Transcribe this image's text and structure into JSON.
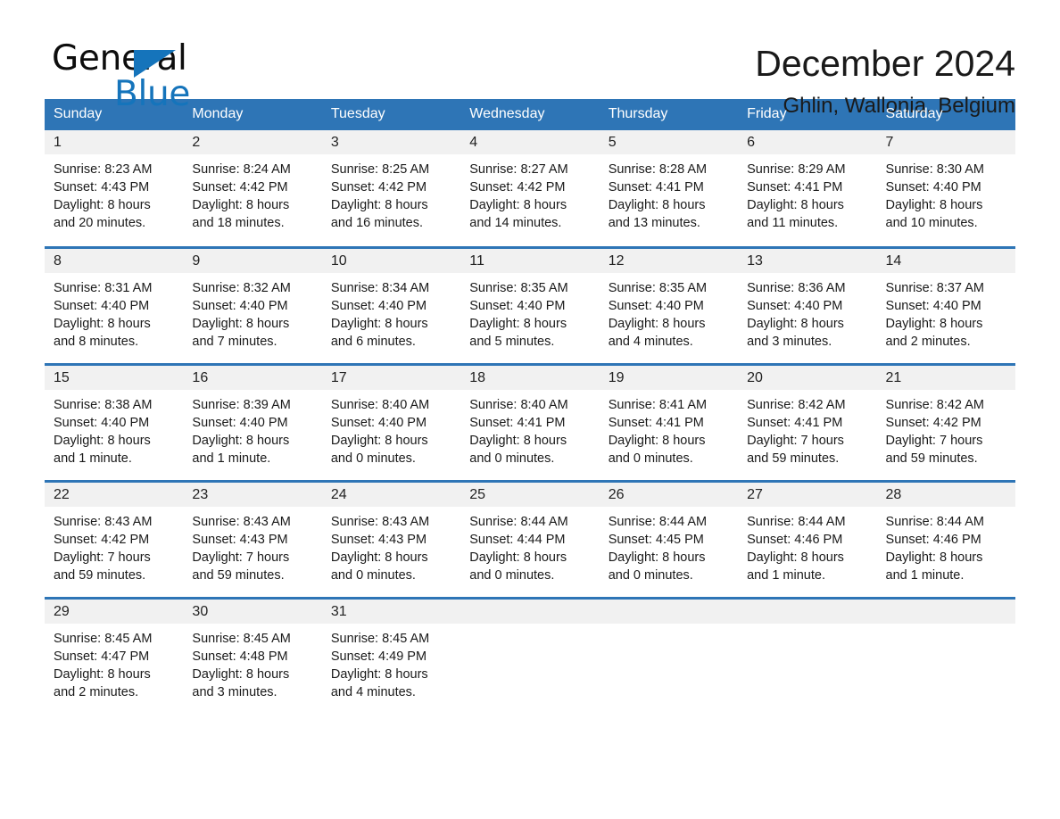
{
  "logo": {
    "word_one": "General",
    "word_two": "Blue",
    "triangle_color": "#1574BB",
    "icon": "general-blue-triangle-logo"
  },
  "header": {
    "month_title": "December 2024",
    "location": "Ghlin, Wallonia, Belgium"
  },
  "theme": {
    "header_blue": "#2E75B6",
    "daynum_band": "#F1F1F1",
    "text": "#1a1a1a"
  },
  "calendar": {
    "weekdays": [
      "Sunday",
      "Monday",
      "Tuesday",
      "Wednesday",
      "Thursday",
      "Friday",
      "Saturday"
    ],
    "weeks": [
      [
        {
          "day": "1",
          "sunrise": "Sunrise: 8:23 AM",
          "sunset": "Sunset: 4:43 PM",
          "daylight_line1": "Daylight: 8 hours",
          "daylight_line2": "and 20 minutes."
        },
        {
          "day": "2",
          "sunrise": "Sunrise: 8:24 AM",
          "sunset": "Sunset: 4:42 PM",
          "daylight_line1": "Daylight: 8 hours",
          "daylight_line2": "and 18 minutes."
        },
        {
          "day": "3",
          "sunrise": "Sunrise: 8:25 AM",
          "sunset": "Sunset: 4:42 PM",
          "daylight_line1": "Daylight: 8 hours",
          "daylight_line2": "and 16 minutes."
        },
        {
          "day": "4",
          "sunrise": "Sunrise: 8:27 AM",
          "sunset": "Sunset: 4:42 PM",
          "daylight_line1": "Daylight: 8 hours",
          "daylight_line2": "and 14 minutes."
        },
        {
          "day": "5",
          "sunrise": "Sunrise: 8:28 AM",
          "sunset": "Sunset: 4:41 PM",
          "daylight_line1": "Daylight: 8 hours",
          "daylight_line2": "and 13 minutes."
        },
        {
          "day": "6",
          "sunrise": "Sunrise: 8:29 AM",
          "sunset": "Sunset: 4:41 PM",
          "daylight_line1": "Daylight: 8 hours",
          "daylight_line2": "and 11 minutes."
        },
        {
          "day": "7",
          "sunrise": "Sunrise: 8:30 AM",
          "sunset": "Sunset: 4:40 PM",
          "daylight_line1": "Daylight: 8 hours",
          "daylight_line2": "and 10 minutes."
        }
      ],
      [
        {
          "day": "8",
          "sunrise": "Sunrise: 8:31 AM",
          "sunset": "Sunset: 4:40 PM",
          "daylight_line1": "Daylight: 8 hours",
          "daylight_line2": "and 8 minutes."
        },
        {
          "day": "9",
          "sunrise": "Sunrise: 8:32 AM",
          "sunset": "Sunset: 4:40 PM",
          "daylight_line1": "Daylight: 8 hours",
          "daylight_line2": "and 7 minutes."
        },
        {
          "day": "10",
          "sunrise": "Sunrise: 8:34 AM",
          "sunset": "Sunset: 4:40 PM",
          "daylight_line1": "Daylight: 8 hours",
          "daylight_line2": "and 6 minutes."
        },
        {
          "day": "11",
          "sunrise": "Sunrise: 8:35 AM",
          "sunset": "Sunset: 4:40 PM",
          "daylight_line1": "Daylight: 8 hours",
          "daylight_line2": "and 5 minutes."
        },
        {
          "day": "12",
          "sunrise": "Sunrise: 8:35 AM",
          "sunset": "Sunset: 4:40 PM",
          "daylight_line1": "Daylight: 8 hours",
          "daylight_line2": "and 4 minutes."
        },
        {
          "day": "13",
          "sunrise": "Sunrise: 8:36 AM",
          "sunset": "Sunset: 4:40 PM",
          "daylight_line1": "Daylight: 8 hours",
          "daylight_line2": "and 3 minutes."
        },
        {
          "day": "14",
          "sunrise": "Sunrise: 8:37 AM",
          "sunset": "Sunset: 4:40 PM",
          "daylight_line1": "Daylight: 8 hours",
          "daylight_line2": "and 2 minutes."
        }
      ],
      [
        {
          "day": "15",
          "sunrise": "Sunrise: 8:38 AM",
          "sunset": "Sunset: 4:40 PM",
          "daylight_line1": "Daylight: 8 hours",
          "daylight_line2": "and 1 minute."
        },
        {
          "day": "16",
          "sunrise": "Sunrise: 8:39 AM",
          "sunset": "Sunset: 4:40 PM",
          "daylight_line1": "Daylight: 8 hours",
          "daylight_line2": "and 1 minute."
        },
        {
          "day": "17",
          "sunrise": "Sunrise: 8:40 AM",
          "sunset": "Sunset: 4:40 PM",
          "daylight_line1": "Daylight: 8 hours",
          "daylight_line2": "and 0 minutes."
        },
        {
          "day": "18",
          "sunrise": "Sunrise: 8:40 AM",
          "sunset": "Sunset: 4:41 PM",
          "daylight_line1": "Daylight: 8 hours",
          "daylight_line2": "and 0 minutes."
        },
        {
          "day": "19",
          "sunrise": "Sunrise: 8:41 AM",
          "sunset": "Sunset: 4:41 PM",
          "daylight_line1": "Daylight: 8 hours",
          "daylight_line2": "and 0 minutes."
        },
        {
          "day": "20",
          "sunrise": "Sunrise: 8:42 AM",
          "sunset": "Sunset: 4:41 PM",
          "daylight_line1": "Daylight: 7 hours",
          "daylight_line2": "and 59 minutes."
        },
        {
          "day": "21",
          "sunrise": "Sunrise: 8:42 AM",
          "sunset": "Sunset: 4:42 PM",
          "daylight_line1": "Daylight: 7 hours",
          "daylight_line2": "and 59 minutes."
        }
      ],
      [
        {
          "day": "22",
          "sunrise": "Sunrise: 8:43 AM",
          "sunset": "Sunset: 4:42 PM",
          "daylight_line1": "Daylight: 7 hours",
          "daylight_line2": "and 59 minutes."
        },
        {
          "day": "23",
          "sunrise": "Sunrise: 8:43 AM",
          "sunset": "Sunset: 4:43 PM",
          "daylight_line1": "Daylight: 7 hours",
          "daylight_line2": "and 59 minutes."
        },
        {
          "day": "24",
          "sunrise": "Sunrise: 8:43 AM",
          "sunset": "Sunset: 4:43 PM",
          "daylight_line1": "Daylight: 8 hours",
          "daylight_line2": "and 0 minutes."
        },
        {
          "day": "25",
          "sunrise": "Sunrise: 8:44 AM",
          "sunset": "Sunset: 4:44 PM",
          "daylight_line1": "Daylight: 8 hours",
          "daylight_line2": "and 0 minutes."
        },
        {
          "day": "26",
          "sunrise": "Sunrise: 8:44 AM",
          "sunset": "Sunset: 4:45 PM",
          "daylight_line1": "Daylight: 8 hours",
          "daylight_line2": "and 0 minutes."
        },
        {
          "day": "27",
          "sunrise": "Sunrise: 8:44 AM",
          "sunset": "Sunset: 4:46 PM",
          "daylight_line1": "Daylight: 8 hours",
          "daylight_line2": "and 1 minute."
        },
        {
          "day": "28",
          "sunrise": "Sunrise: 8:44 AM",
          "sunset": "Sunset: 4:46 PM",
          "daylight_line1": "Daylight: 8 hours",
          "daylight_line2": "and 1 minute."
        }
      ],
      [
        {
          "day": "29",
          "sunrise": "Sunrise: 8:45 AM",
          "sunset": "Sunset: 4:47 PM",
          "daylight_line1": "Daylight: 8 hours",
          "daylight_line2": "and 2 minutes."
        },
        {
          "day": "30",
          "sunrise": "Sunrise: 8:45 AM",
          "sunset": "Sunset: 4:48 PM",
          "daylight_line1": "Daylight: 8 hours",
          "daylight_line2": "and 3 minutes."
        },
        {
          "day": "31",
          "sunrise": "Sunrise: 8:45 AM",
          "sunset": "Sunset: 4:49 PM",
          "daylight_line1": "Daylight: 8 hours",
          "daylight_line2": "and 4 minutes."
        },
        {
          "day": "",
          "sunrise": "",
          "sunset": "",
          "daylight_line1": "",
          "daylight_line2": ""
        },
        {
          "day": "",
          "sunrise": "",
          "sunset": "",
          "daylight_line1": "",
          "daylight_line2": ""
        },
        {
          "day": "",
          "sunrise": "",
          "sunset": "",
          "daylight_line1": "",
          "daylight_line2": ""
        },
        {
          "day": "",
          "sunrise": "",
          "sunset": "",
          "daylight_line1": "",
          "daylight_line2": ""
        }
      ]
    ]
  }
}
